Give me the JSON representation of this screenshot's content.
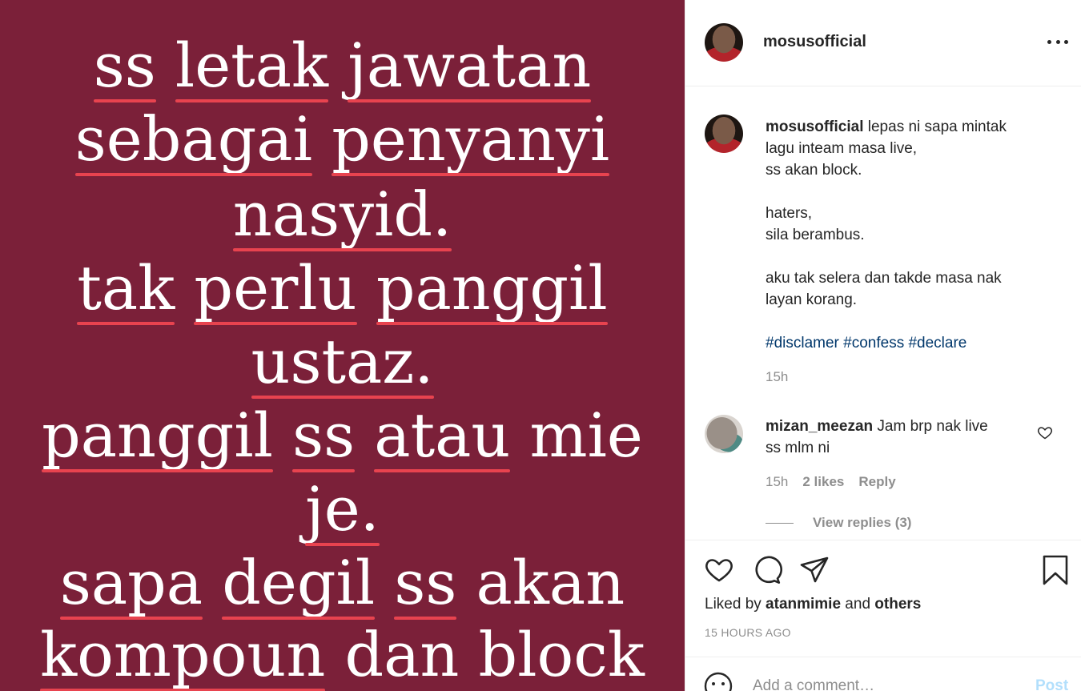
{
  "post_image": {
    "background": "#7b2039",
    "underline_color": "#e8434f",
    "lines": [
      [
        "ss",
        "letak",
        "jawatan"
      ],
      [
        "sebagai",
        "penyanyi"
      ],
      [
        "nasyid."
      ],
      [
        "tak",
        "perlu",
        "panggil"
      ],
      [
        "ustaz."
      ],
      [
        "panggil",
        "ss",
        "atau",
        "mie"
      ],
      [
        "je."
      ],
      [
        "sapa",
        "degil",
        "ss",
        "akan"
      ],
      [
        "kompoun",
        "dan",
        "block"
      ]
    ]
  },
  "header": {
    "username": "mosusofficial",
    "more_icon": "more-horizontal-icon"
  },
  "caption": {
    "username": "mosusofficial",
    "line1": "lepas ni sapa mintak",
    "line2": "lagu inteam masa live,",
    "line3": "ss akan block.",
    "line4": "haters,",
    "line5": "sila berambus.",
    "line6": "aku tak selera dan takde masa nak",
    "line7": "layan korang.",
    "hashtags": "#disclamer #confess #declare",
    "time": "15h"
  },
  "comment": {
    "username": "mizan_meezan",
    "text_line1": "Jam brp nak live",
    "text_line2": "ss mlm ni",
    "time": "15h",
    "likes": "2 likes",
    "reply": "Reply",
    "view_replies": "View replies (3)"
  },
  "actions": {
    "like_icon": "heart-icon",
    "comment_icon": "comment-icon",
    "share_icon": "paper-plane-icon",
    "save_icon": "bookmark-icon"
  },
  "likes": {
    "prefix": "Liked by ",
    "user": "atanmimie",
    "middle": " and ",
    "others": "others"
  },
  "timestamp": "15 HOURS AGO",
  "add_comment": {
    "placeholder": "Add a comment…",
    "post_label": "Post"
  }
}
